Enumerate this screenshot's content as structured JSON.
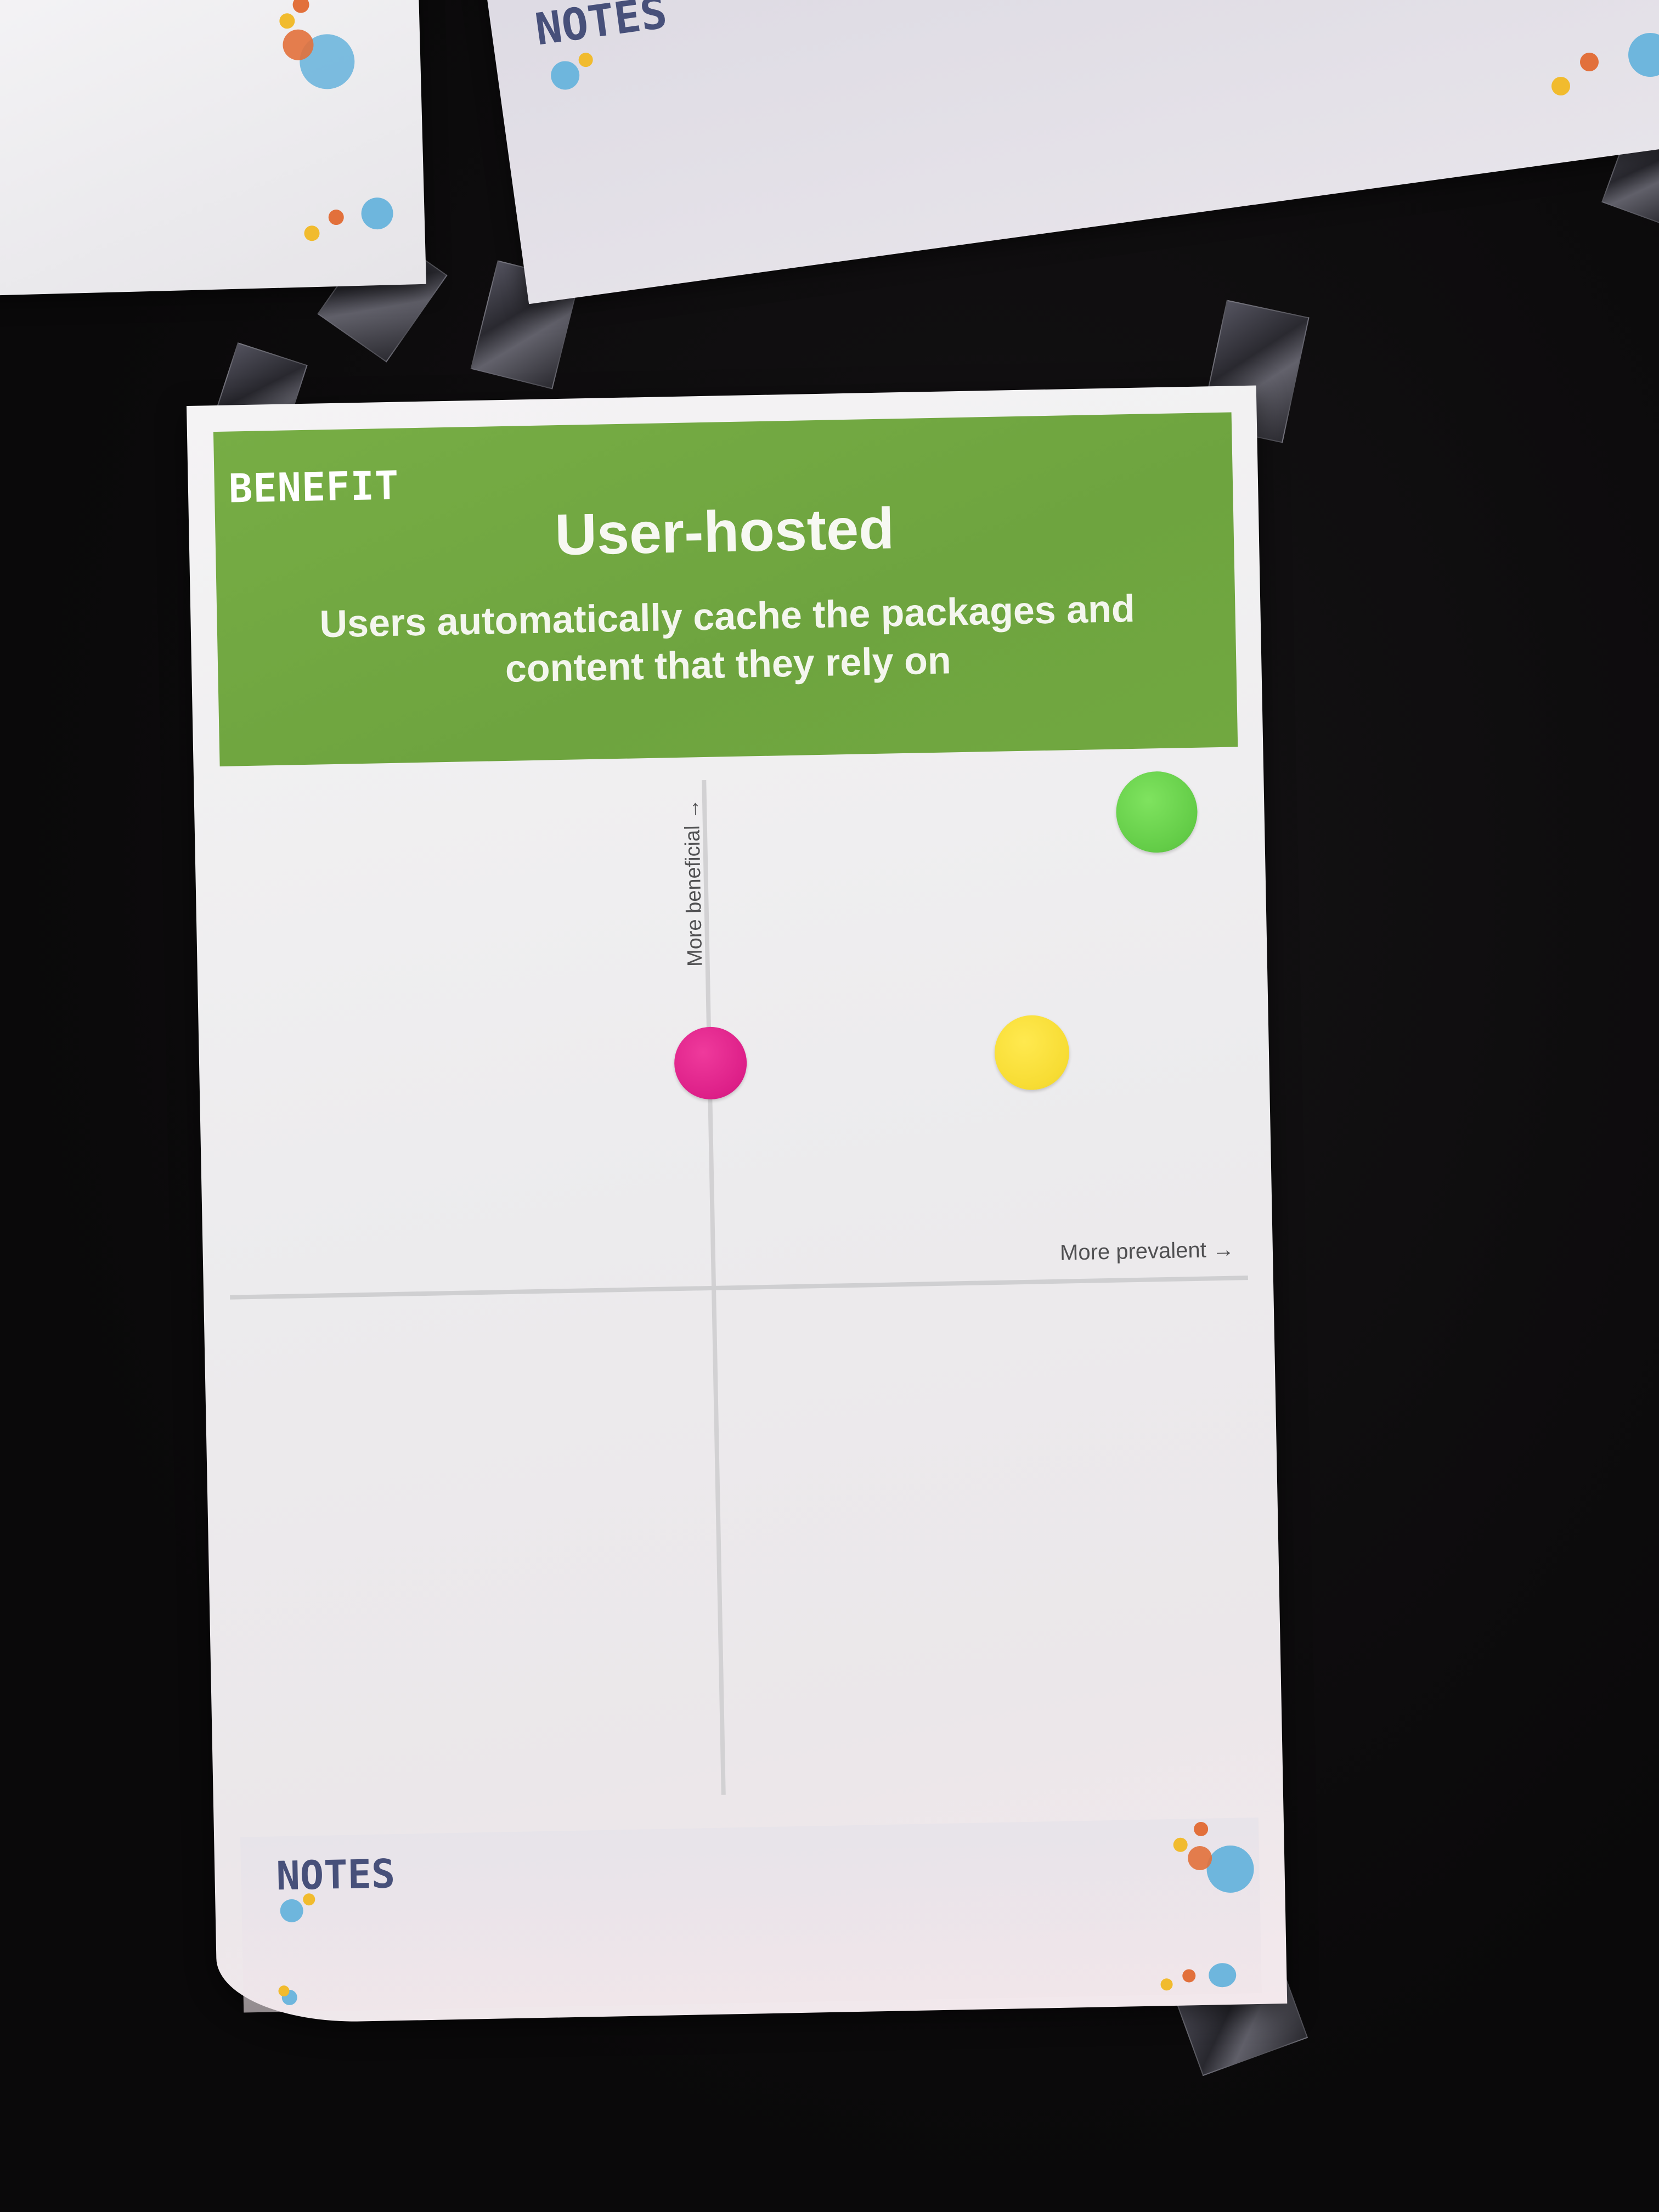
{
  "main_card": {
    "category": "BENEFIT",
    "title": "User-hosted",
    "description": "Users automatically cache the packages and content that they rely on",
    "y_axis_label": "More beneficial →",
    "x_axis_label": "More prevalent →",
    "header_color": "#72a842",
    "notes_label": "NOTES"
  },
  "background_cards": {
    "top_right_notes_label": "NOTES"
  },
  "votes": [
    {
      "color_name": "green",
      "color": "#6ed64f"
    },
    {
      "color_name": "magenta",
      "color": "#e3278f"
    },
    {
      "color_name": "yellow",
      "color": "#fbe13d"
    }
  ],
  "colors": {
    "background": "#0b0a0b",
    "paper": "#f2f1f3",
    "notes_text": "#47507a",
    "confetti_blue": "#6eb6dd",
    "confetti_orange": "#e2703b",
    "confetti_yellow": "#f1bb2e"
  }
}
